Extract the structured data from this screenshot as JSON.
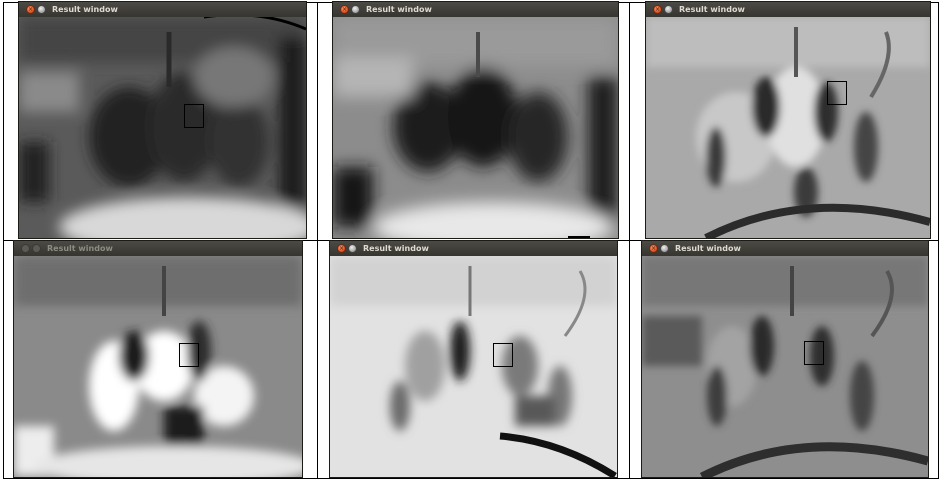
{
  "windows": [
    {
      "title": "Result window"
    },
    {
      "title": "Result window"
    },
    {
      "title": "Result window"
    },
    {
      "title": "Result window"
    },
    {
      "title": "Result window"
    },
    {
      "title": "Result window"
    }
  ],
  "icons": {
    "close": "close-icon",
    "minimize": "minimize-icon"
  },
  "colors": {
    "titlebar": "#3c3b37",
    "frame": "#2f2e2a",
    "title_text": "#dfdbd2",
    "close_button": "#e05a24"
  }
}
